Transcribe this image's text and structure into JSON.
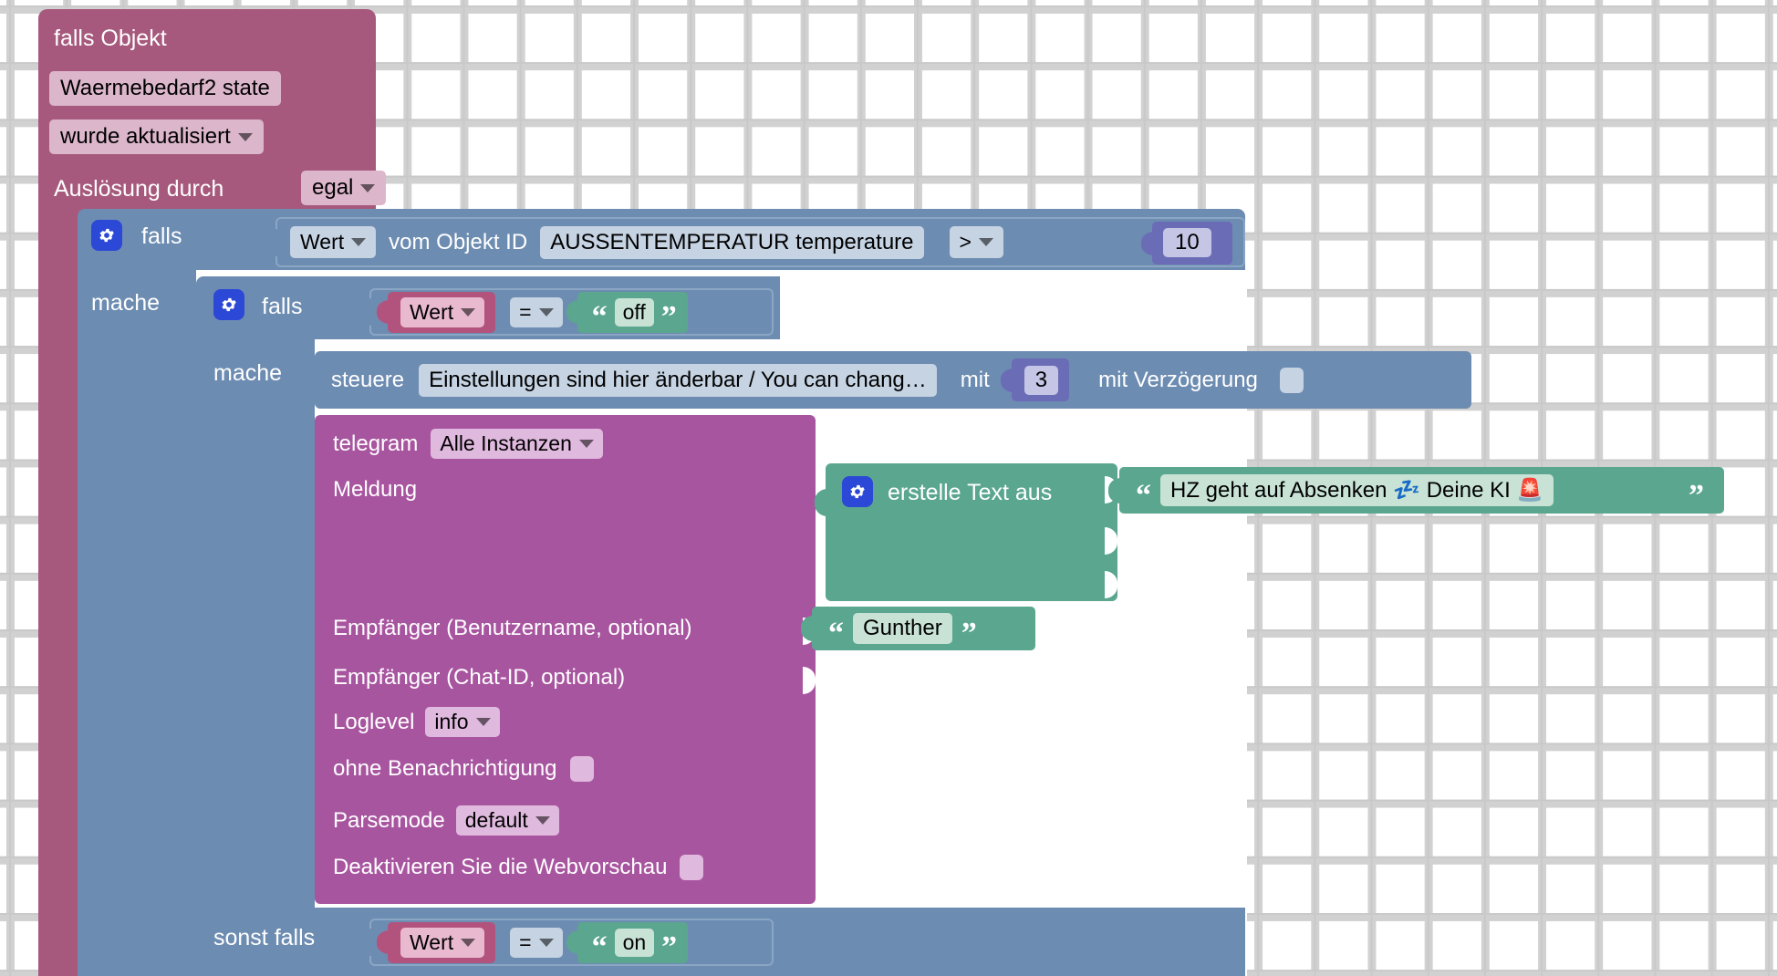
{
  "app": {
    "name": "ioBroker Blockly Script Editor",
    "workspace_background": "#ffffff",
    "grid_color": "#c9c9c9"
  },
  "colors": {
    "trigger_pink": "#a6597c",
    "control_blue": "#6d8cb1",
    "text_green": "#5aa68f",
    "telegram_magenta": "#a855a0",
    "math_purple": "#6b6cb6",
    "variable_pink": "#b2537d",
    "gear_blue": "#2b48d6"
  },
  "blocks": {
    "trigger": {
      "title": "falls Objekt",
      "object_id": "Waermebedarf2 state",
      "condition_mode": "wurde aktualisiert",
      "trigger_by_label": "Auslösung durch",
      "trigger_by_value": "egal"
    },
    "if_outer": {
      "if_label": "falls",
      "do_label": "mache",
      "gear_icon": "gear-icon",
      "condition": {
        "attribute": "Wert",
        "of_object_label": "vom Objekt ID",
        "object_id": "AUSSENTEMPERATUR temperature",
        "operator": ">",
        "value": "10"
      }
    },
    "if_inner": {
      "if_label": "falls",
      "do_label": "mache",
      "else_if_label": "sonst falls",
      "gear_icon": "gear-icon",
      "condition": {
        "variable": "Wert",
        "operator": "=",
        "compare_text": "off"
      },
      "else_condition": {
        "variable": "Wert",
        "operator": "=",
        "compare_text": "on"
      }
    },
    "control": {
      "verb": "steuere",
      "object_id": "Einstellungen sind hier änderbar / You can chang…",
      "with_label": "mit",
      "value": "3",
      "delay_label": "mit Verzögerung",
      "delay_checked": false
    },
    "telegram": {
      "title": "telegram",
      "instance": "Alle Instanzen",
      "message_label": "Meldung",
      "recipient_user_label": "Empfänger (Benutzername, optional)",
      "recipient_user_value": "Gunther",
      "recipient_chatid_label": "Empfänger (Chat-ID, optional)",
      "loglevel_label": "Loglevel",
      "loglevel_value": "info",
      "silent_label": "ohne Benachrichtigung",
      "silent_checked": false,
      "parsemode_label": "Parsemode",
      "parsemode_value": "default",
      "disable_webpreview_label": "Deaktivieren Sie die Webvorschau",
      "disable_webpreview_checked": false
    },
    "text_join": {
      "label": "erstelle Text aus",
      "gear_icon": "gear-icon",
      "item_1": "HZ geht auf Absenken 💤 Deine KI 🚨"
    }
  }
}
